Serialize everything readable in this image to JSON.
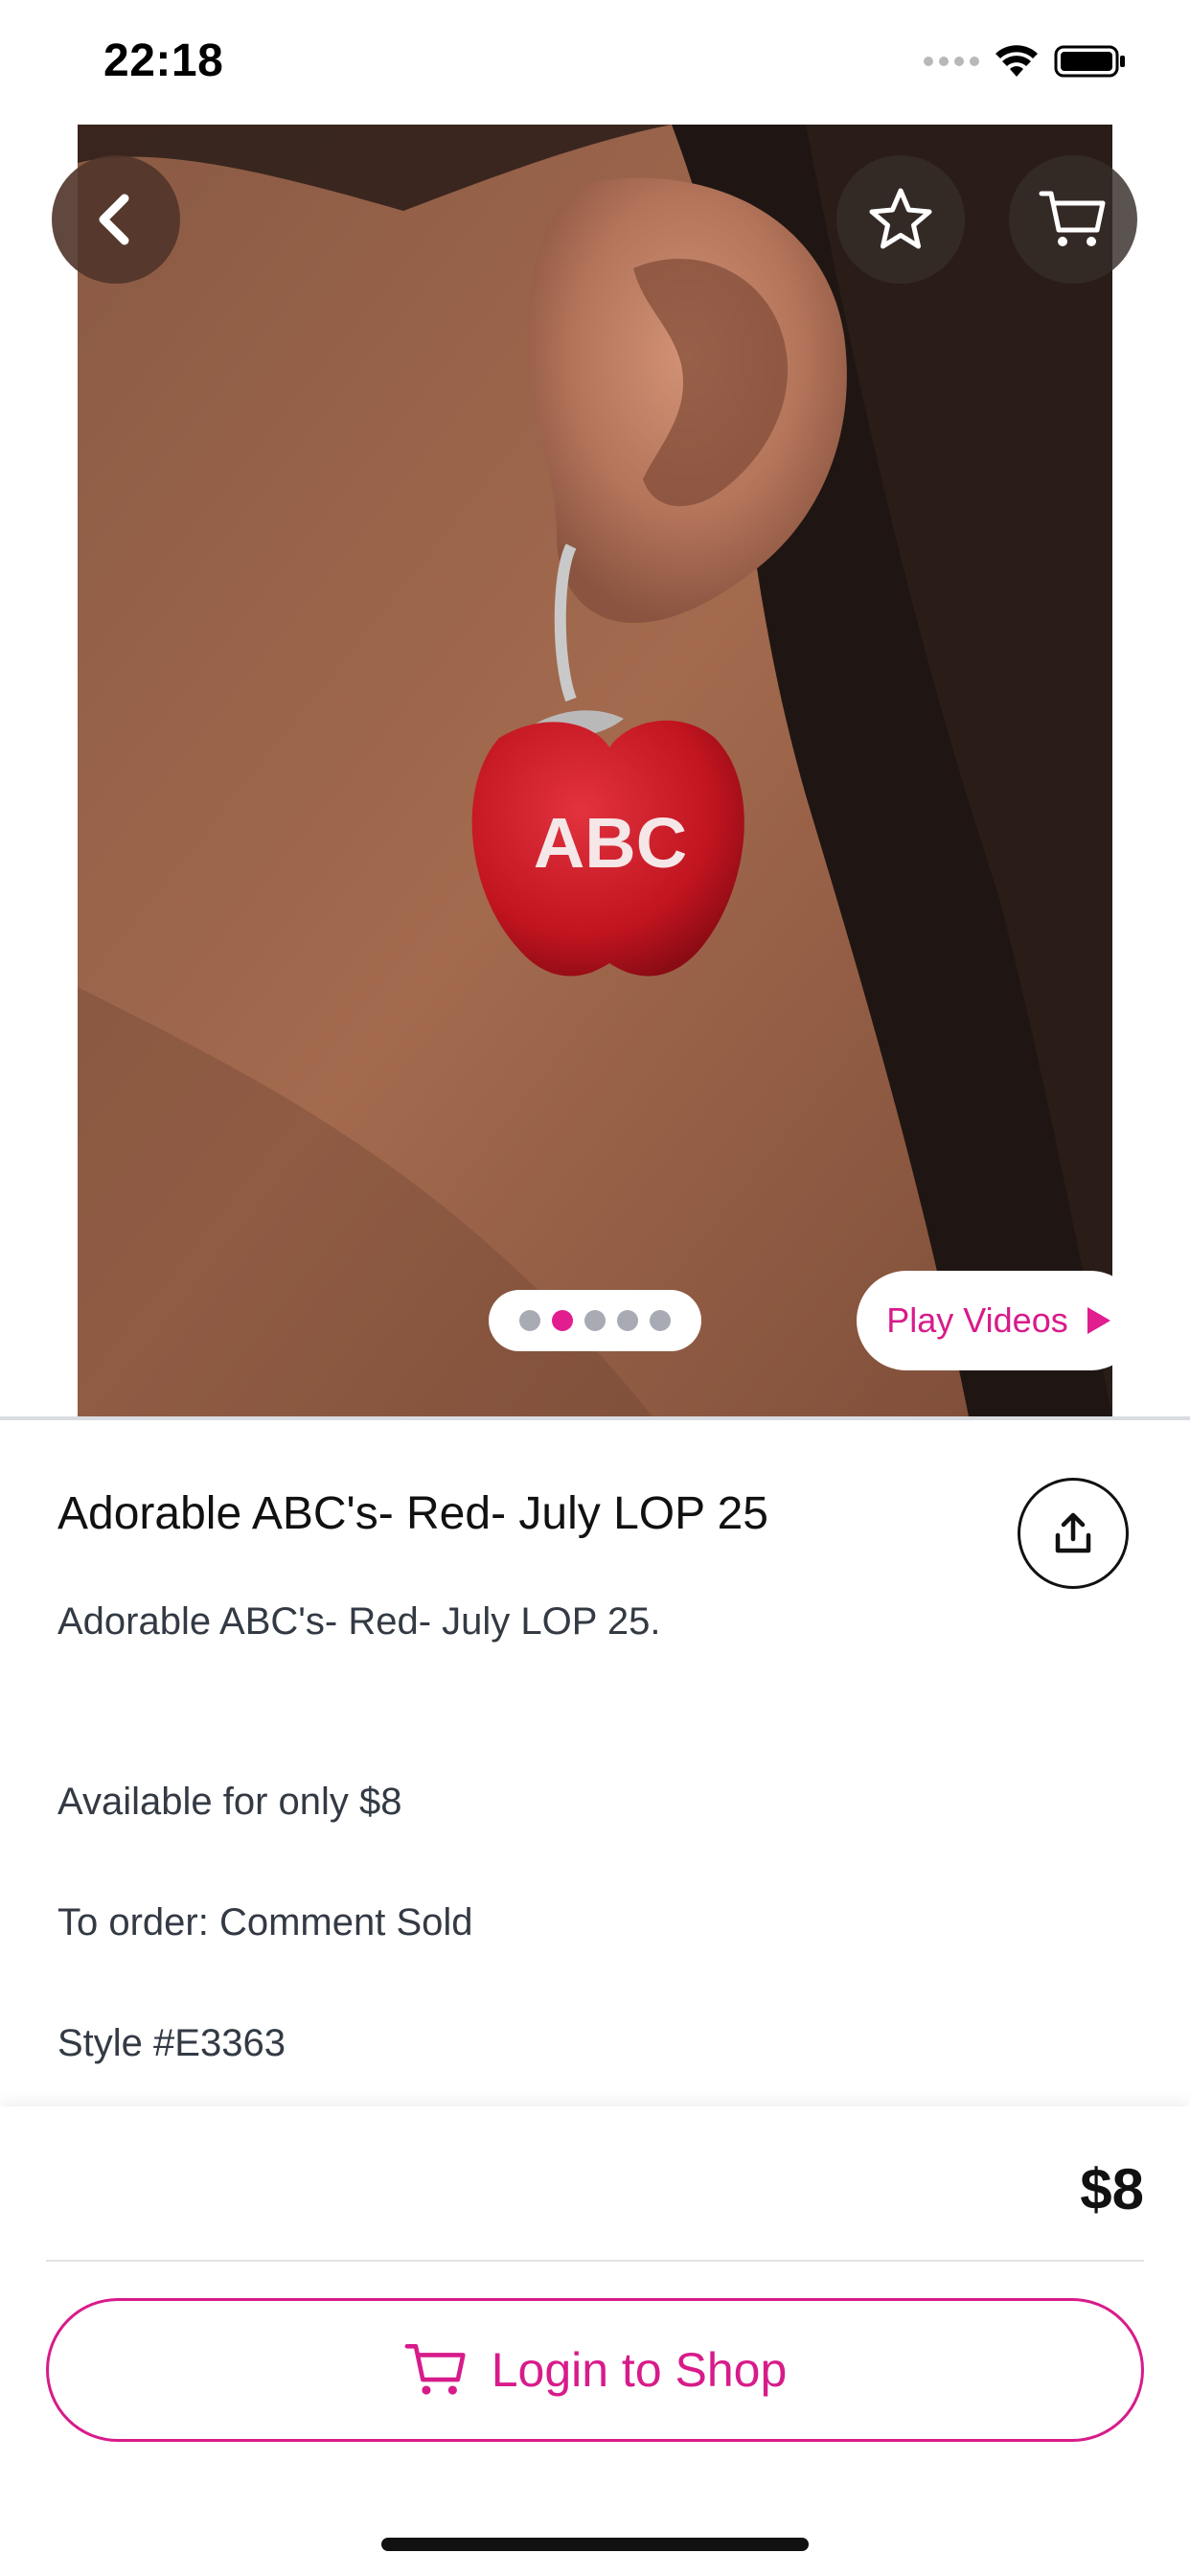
{
  "status_bar": {
    "time": "22:18"
  },
  "hero": {
    "back_icon": "chevron-left-icon",
    "favorite_icon": "star-icon",
    "cart_icon": "cart-icon",
    "image_text": "ABC",
    "pager": {
      "count": 5,
      "active_index": 1
    },
    "play_videos_label": "Play Videos"
  },
  "product": {
    "title": "Adorable ABC's- Red- July LOP 25",
    "subtitle": "Adorable ABC's- Red- July LOP 25.",
    "availability": "Available for only $8",
    "order_info": "To order: Comment Sold",
    "style": "Style #E3363",
    "share_icon": "share-icon"
  },
  "purchase": {
    "price": "$8",
    "login_button_label": "Login to Shop"
  },
  "colors": {
    "accent": "#E11D8F",
    "text": "#111111",
    "muted_text": "#333A44"
  }
}
